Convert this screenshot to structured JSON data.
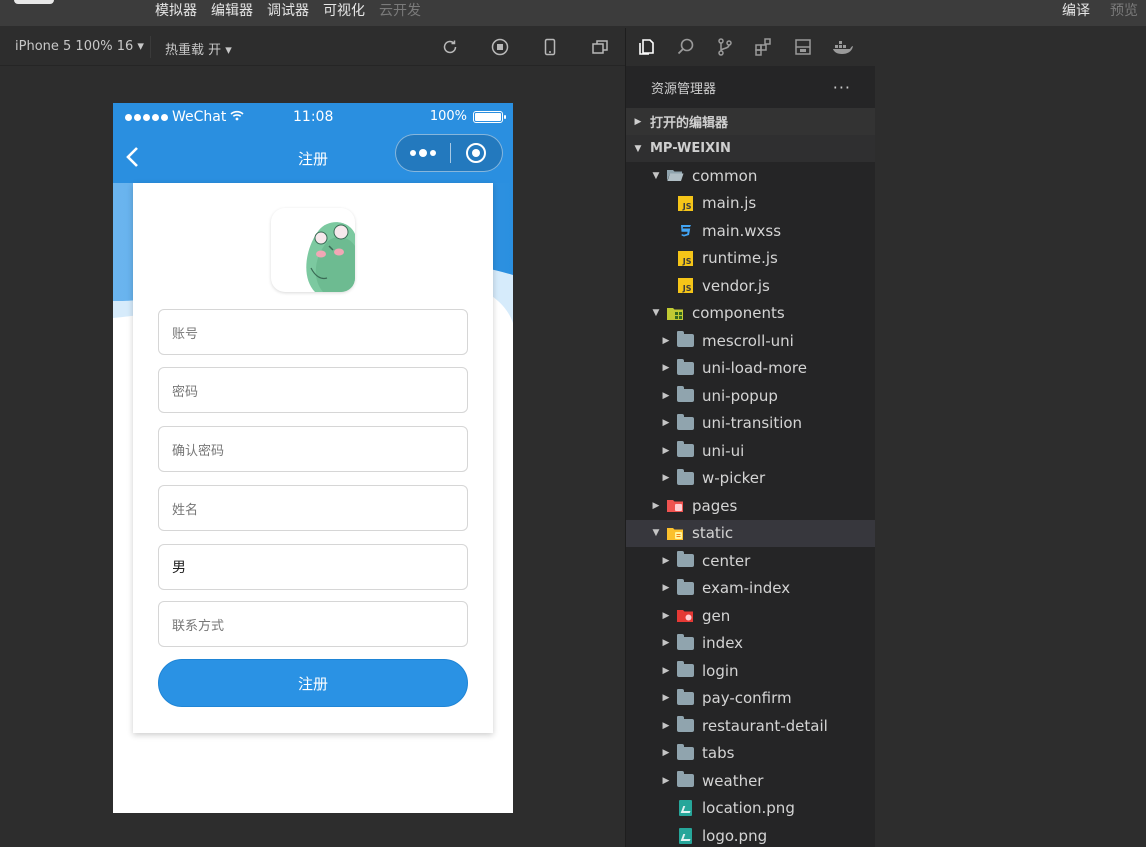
{
  "menubar": {
    "items": [
      "模拟器",
      "编辑器",
      "调试器",
      "可视化",
      "云开发"
    ],
    "right": [
      "编译",
      "预览"
    ]
  },
  "simbar": {
    "device": "iPhone 5 100% 16 ▾",
    "hot_reload": "热重载 开 ▾"
  },
  "phone": {
    "status": {
      "carrier": "WeChat",
      "time": "11:08",
      "battery": "100%"
    },
    "nav_title": "注册",
    "fields": [
      {
        "placeholder": "账号"
      },
      {
        "placeholder": "密码"
      },
      {
        "placeholder": "确认密码"
      },
      {
        "placeholder": "姓名"
      },
      {
        "value": "男"
      },
      {
        "placeholder": "联系方式"
      }
    ],
    "submit_label": "注册"
  },
  "explorer": {
    "title": "资源管理器",
    "open_editors": "打开的编辑器",
    "project": "MP-WEIXIN",
    "tree": [
      {
        "label": "common",
        "type": "folder-open",
        "depth": 1,
        "expanded": true
      },
      {
        "label": "main.js",
        "type": "js",
        "depth": 2
      },
      {
        "label": "main.wxss",
        "type": "css",
        "depth": 2
      },
      {
        "label": "runtime.js",
        "type": "js",
        "depth": 2
      },
      {
        "label": "vendor.js",
        "type": "js",
        "depth": 2
      },
      {
        "label": "components",
        "type": "folder-components",
        "depth": 1,
        "expanded": true
      },
      {
        "label": "mescroll-uni",
        "type": "folder",
        "depth": 2
      },
      {
        "label": "uni-load-more",
        "type": "folder",
        "depth": 2
      },
      {
        "label": "uni-popup",
        "type": "folder",
        "depth": 2
      },
      {
        "label": "uni-transition",
        "type": "folder",
        "depth": 2
      },
      {
        "label": "uni-ui",
        "type": "folder",
        "depth": 2
      },
      {
        "label": "w-picker",
        "type": "folder",
        "depth": 2
      },
      {
        "label": "pages",
        "type": "folder-pages",
        "depth": 1
      },
      {
        "label": "static",
        "type": "folder-static",
        "depth": 1,
        "expanded": true,
        "selected": true
      },
      {
        "label": "center",
        "type": "folder",
        "depth": 2
      },
      {
        "label": "exam-index",
        "type": "folder",
        "depth": 2
      },
      {
        "label": "gen",
        "type": "folder-gen",
        "depth": 2
      },
      {
        "label": "index",
        "type": "folder",
        "depth": 2
      },
      {
        "label": "login",
        "type": "folder",
        "depth": 2
      },
      {
        "label": "pay-confirm",
        "type": "folder",
        "depth": 2
      },
      {
        "label": "restaurant-detail",
        "type": "folder",
        "depth": 2
      },
      {
        "label": "tabs",
        "type": "folder",
        "depth": 2
      },
      {
        "label": "weather",
        "type": "folder",
        "depth": 2
      },
      {
        "label": "location.png",
        "type": "png",
        "depth": 2
      },
      {
        "label": "logo.png",
        "type": "png",
        "depth": 2
      }
    ]
  },
  "colors": {
    "wechat_blue": "#2a8fe0",
    "button_blue": "#2a92e4",
    "explorer_bg": "#252526",
    "folder_gray": "#90a4ae",
    "js_yellow": "#f5c518"
  }
}
